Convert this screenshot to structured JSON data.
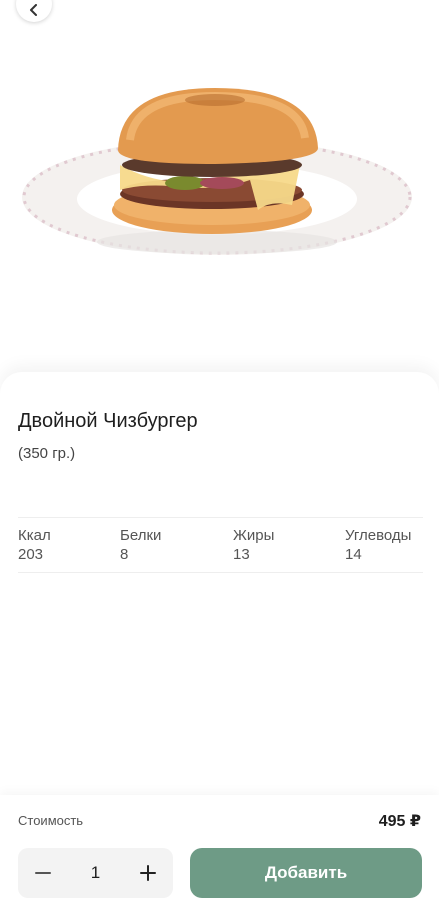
{
  "product": {
    "name": "Двойной Чизбургер",
    "weight": "(350 гр.)",
    "image_icon": "burger-on-plate-image"
  },
  "nutrition": [
    {
      "label": "Ккал",
      "value": "203"
    },
    {
      "label": "Белки",
      "value": "8"
    },
    {
      "label": "Жиры",
      "value": "13"
    },
    {
      "label": "Углеводы",
      "value": "14"
    }
  ],
  "footer": {
    "cost_label": "Стоимость",
    "cost_value": "495 ₽",
    "quantity": "1",
    "add_label": "Добавить"
  },
  "icons": {
    "back": "chevron-left-icon",
    "minus": "minus-icon",
    "plus": "plus-icon"
  },
  "colors": {
    "accent": "#6e9b86",
    "stepper_bg": "#f3f3f3"
  }
}
